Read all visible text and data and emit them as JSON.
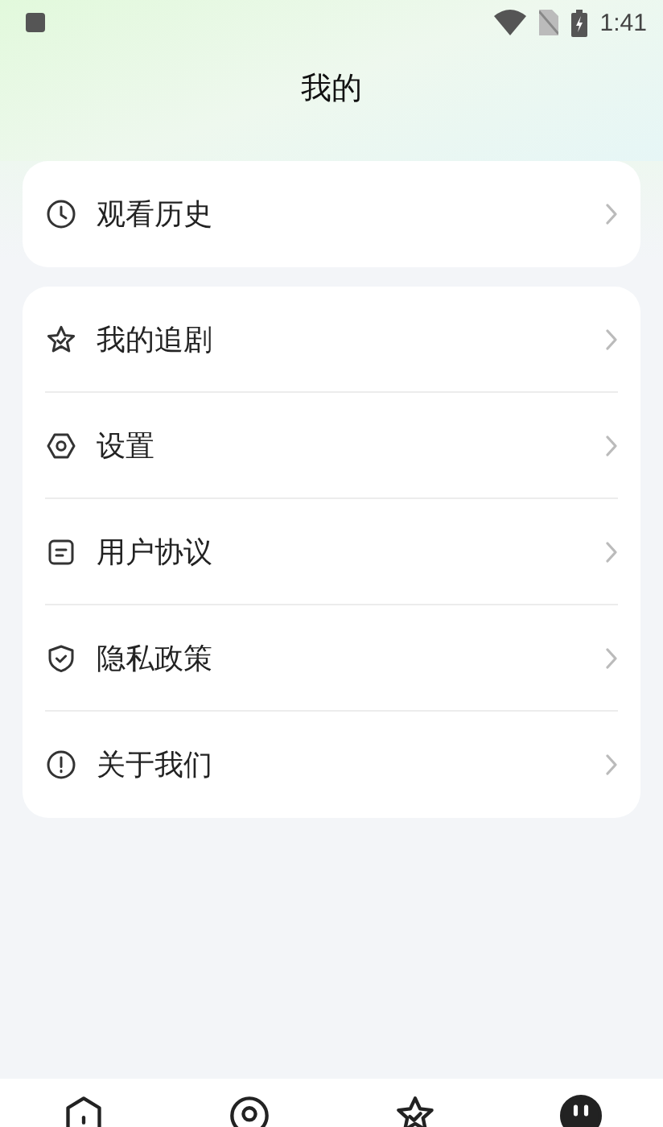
{
  "status_bar": {
    "time": "1:41"
  },
  "title": "我的",
  "groups": [
    {
      "items": [
        {
          "kind": "clock",
          "label": "观看历史"
        }
      ]
    },
    {
      "items": [
        {
          "kind": "star",
          "label": "我的追剧"
        },
        {
          "kind": "hexagon",
          "label": "设置"
        },
        {
          "kind": "document",
          "label": "用户协议"
        },
        {
          "kind": "shield",
          "label": "隐私政策"
        },
        {
          "kind": "info",
          "label": "关于我们"
        }
      ]
    }
  ],
  "nav": [
    {
      "kind": "home",
      "selected": false
    },
    {
      "kind": "target",
      "selected": false
    },
    {
      "kind": "star",
      "selected": false
    },
    {
      "kind": "face",
      "selected": true
    }
  ]
}
